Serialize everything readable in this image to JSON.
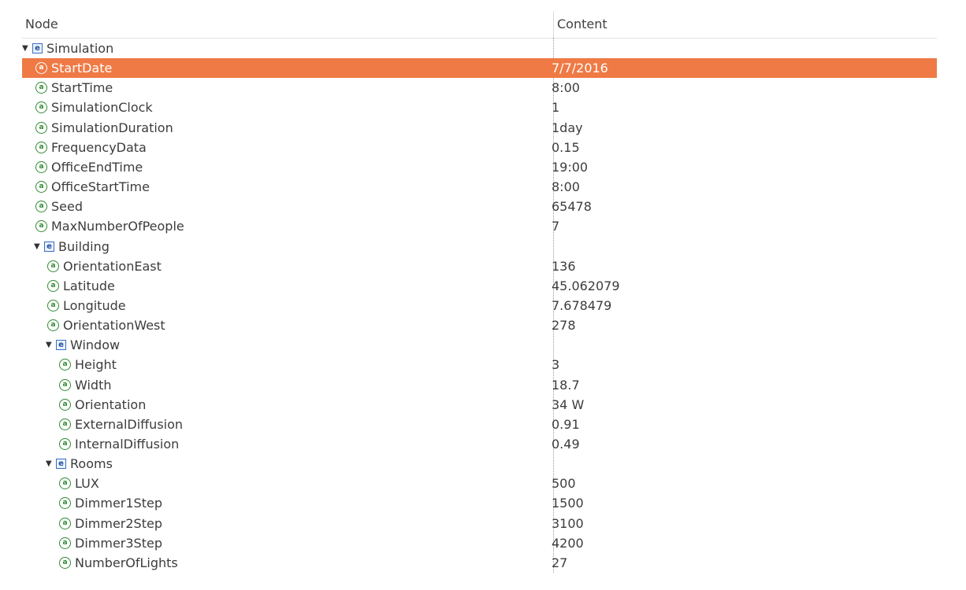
{
  "header": {
    "node_label": "Node",
    "content_label": "Content"
  },
  "icons": {
    "element_icon": "e",
    "attribute_icon": "a"
  },
  "colors": {
    "selection": "#ef7a45",
    "element_icon": "#3a6fc4",
    "attribute_icon": "#2f8a31"
  },
  "rows": [
    {
      "type": "element",
      "name": "Simulation",
      "content": "",
      "expanded": true,
      "selected": false
    },
    {
      "type": "attribute",
      "name": "StartDate",
      "content": "7/7/2016",
      "selected": true
    },
    {
      "type": "attribute",
      "name": "StartTime",
      "content": "8:00",
      "selected": false
    },
    {
      "type": "attribute",
      "name": "SimulationClock",
      "content": "1",
      "selected": false
    },
    {
      "type": "attribute",
      "name": "SimulationDuration",
      "content": "1day",
      "selected": false
    },
    {
      "type": "attribute",
      "name": "FrequencyData",
      "content": "0.15",
      "selected": false
    },
    {
      "type": "attribute",
      "name": "OfficeEndTime",
      "content": "19:00",
      "selected": false
    },
    {
      "type": "attribute",
      "name": "OfficeStartTime",
      "content": "8:00",
      "selected": false
    },
    {
      "type": "attribute",
      "name": "Seed",
      "content": "65478",
      "selected": false
    },
    {
      "type": "attribute",
      "name": "MaxNumberOfPeople",
      "content": "7",
      "selected": false
    },
    {
      "type": "element",
      "name": "Building",
      "content": "",
      "expanded": true,
      "selected": false
    },
    {
      "type": "attribute",
      "name": "OrientationEast",
      "content": "136",
      "selected": false
    },
    {
      "type": "attribute",
      "name": "Latitude",
      "content": "45.062079",
      "selected": false
    },
    {
      "type": "attribute",
      "name": "Longitude",
      "content": "7.678479",
      "selected": false
    },
    {
      "type": "attribute",
      "name": "OrientationWest",
      "content": "278",
      "selected": false
    },
    {
      "type": "element",
      "name": "Window",
      "content": "",
      "expanded": true,
      "selected": false
    },
    {
      "type": "attribute",
      "name": "Height",
      "content": "3",
      "selected": false
    },
    {
      "type": "attribute",
      "name": "Width",
      "content": "18.7",
      "selected": false
    },
    {
      "type": "attribute",
      "name": "Orientation",
      "content": "34 W",
      "selected": false
    },
    {
      "type": "attribute",
      "name": "ExternalDiffusion",
      "content": "0.91",
      "selected": false
    },
    {
      "type": "attribute",
      "name": "InternalDiffusion",
      "content": "0.49",
      "selected": false
    },
    {
      "type": "element",
      "name": "Rooms",
      "content": "",
      "expanded": true,
      "selected": false
    },
    {
      "type": "attribute",
      "name": "LUX",
      "content": "500",
      "selected": false
    },
    {
      "type": "attribute",
      "name": "Dimmer1Step",
      "content": "1500",
      "selected": false
    },
    {
      "type": "attribute",
      "name": "Dimmer2Step",
      "content": "3100",
      "selected": false
    },
    {
      "type": "attribute",
      "name": "Dimmer3Step",
      "content": "4200",
      "selected": false
    },
    {
      "type": "attribute",
      "name": "NumberOfLights",
      "content": "27",
      "selected": false
    }
  ]
}
